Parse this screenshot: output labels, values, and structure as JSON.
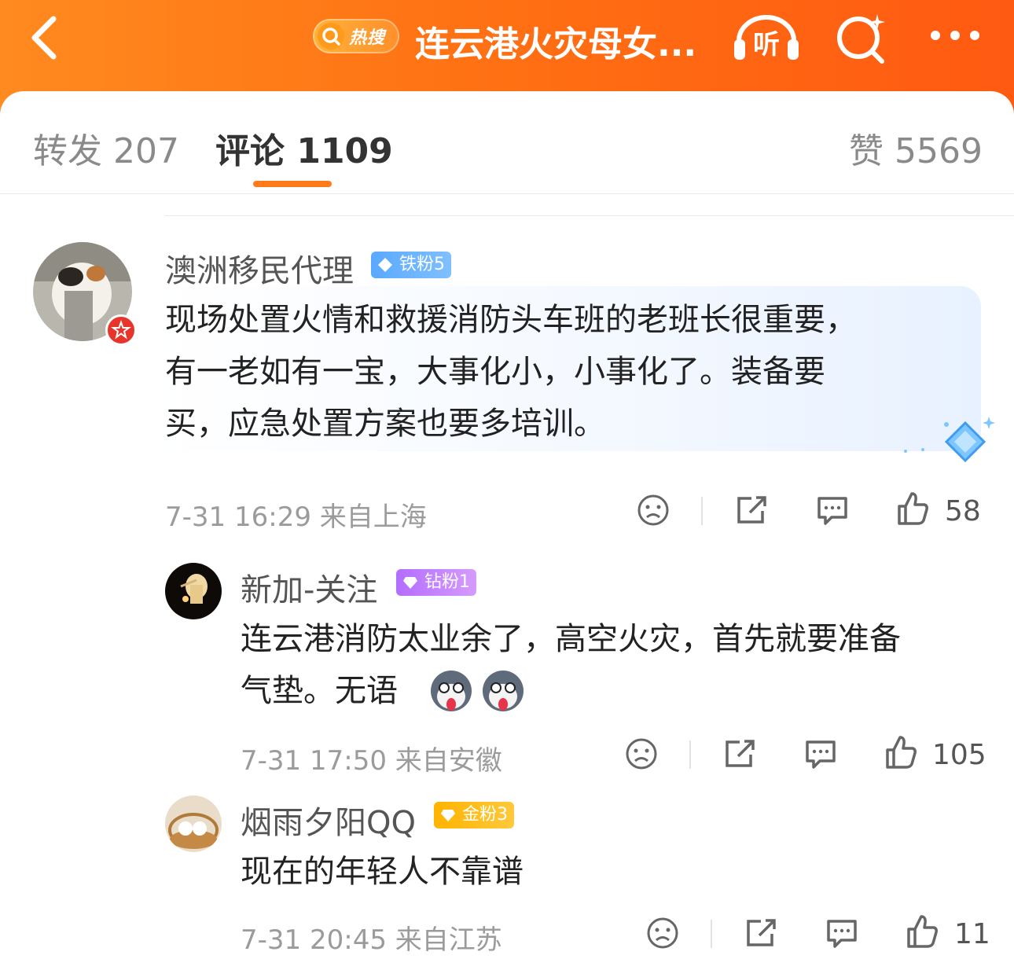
{
  "header": {
    "hot_label": "热搜",
    "title": "连云港火灾母女...",
    "listen_label": "听"
  },
  "tabs": [
    {
      "label": "转发",
      "count": "207"
    },
    {
      "label": "评论",
      "count": "1109"
    },
    {
      "label": "赞",
      "count": "5569"
    }
  ],
  "comments": [
    {
      "user": "澳洲移民代理",
      "badge": "铁粉5",
      "lines": [
        "现场处置火情和救援消防头车班的老班长很重要，",
        "有一老如有一宝，大事化小，小事化了。装备要",
        "买，应急处置方案也要多培训。"
      ],
      "time": "7-31 16:29",
      "location": "来自上海",
      "likes": "58"
    },
    {
      "user": "新加-关注",
      "badge": "钻粉1",
      "lines": [
        "连云港消防太业余了，高空火灾，首先就要准备",
        "气垫。无语"
      ],
      "time": "7-31 17:50",
      "location": "来自安徽",
      "likes": "105"
    },
    {
      "user": "烟雨夕阳QQ",
      "badge": "金粉3",
      "lines": [
        "现在的年轻人不靠谱"
      ],
      "time": "7-31 20:45",
      "location": "来自江苏",
      "likes": "11"
    }
  ],
  "colors": {
    "accent": "#ff6a10",
    "tab_underline": "#ff7a1a"
  }
}
